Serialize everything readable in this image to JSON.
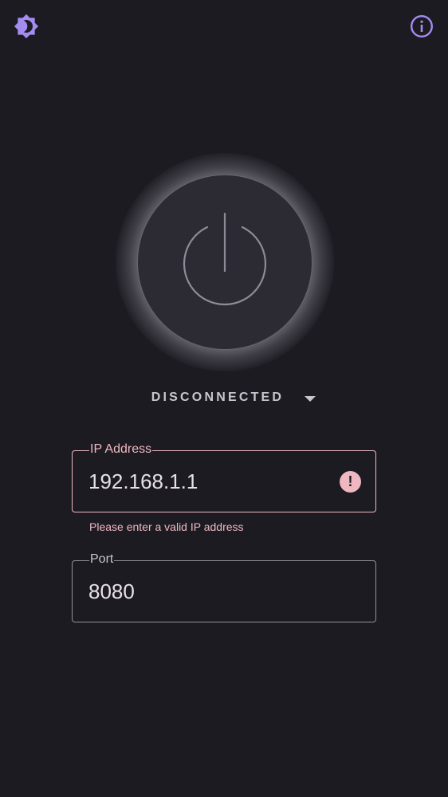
{
  "header": {
    "theme_icon": "brightness-moon-icon",
    "info_icon": "info-icon",
    "accent_color": "#a38cf0"
  },
  "power": {
    "icon": "power-icon"
  },
  "status": {
    "label": "DISCONNECTED",
    "caret_icon": "caret-down-icon"
  },
  "ip_field": {
    "label": "IP Address",
    "value": "192.168.1.1",
    "error_icon": "!",
    "error_message": "Please enter a valid IP address",
    "error_color": "#efb8c0"
  },
  "port_field": {
    "label": "Port",
    "value": "8080"
  }
}
